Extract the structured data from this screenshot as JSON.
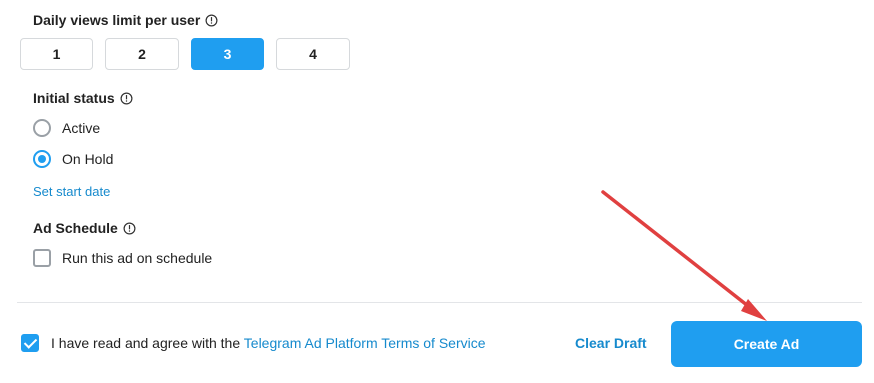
{
  "daily_views": {
    "label": "Daily views limit per user",
    "options": [
      "1",
      "2",
      "3",
      "4"
    ],
    "selected": "3"
  },
  "initial_status": {
    "label": "Initial status",
    "options": [
      "Active",
      "On Hold"
    ],
    "selected": "On Hold",
    "start_date_link": "Set start date"
  },
  "ad_schedule": {
    "label": "Ad Schedule",
    "checkbox_label": "Run this ad on schedule",
    "checked": false
  },
  "footer": {
    "agree_prefix": "I have read and agree with the ",
    "terms_link": "Telegram Ad Platform Terms of Service",
    "agree_checked": true,
    "clear_draft": "Clear Draft",
    "create_ad": "Create Ad"
  },
  "colors": {
    "accent": "#1f9ef0",
    "link": "#168acd",
    "annotation_arrow": "#e04040"
  }
}
